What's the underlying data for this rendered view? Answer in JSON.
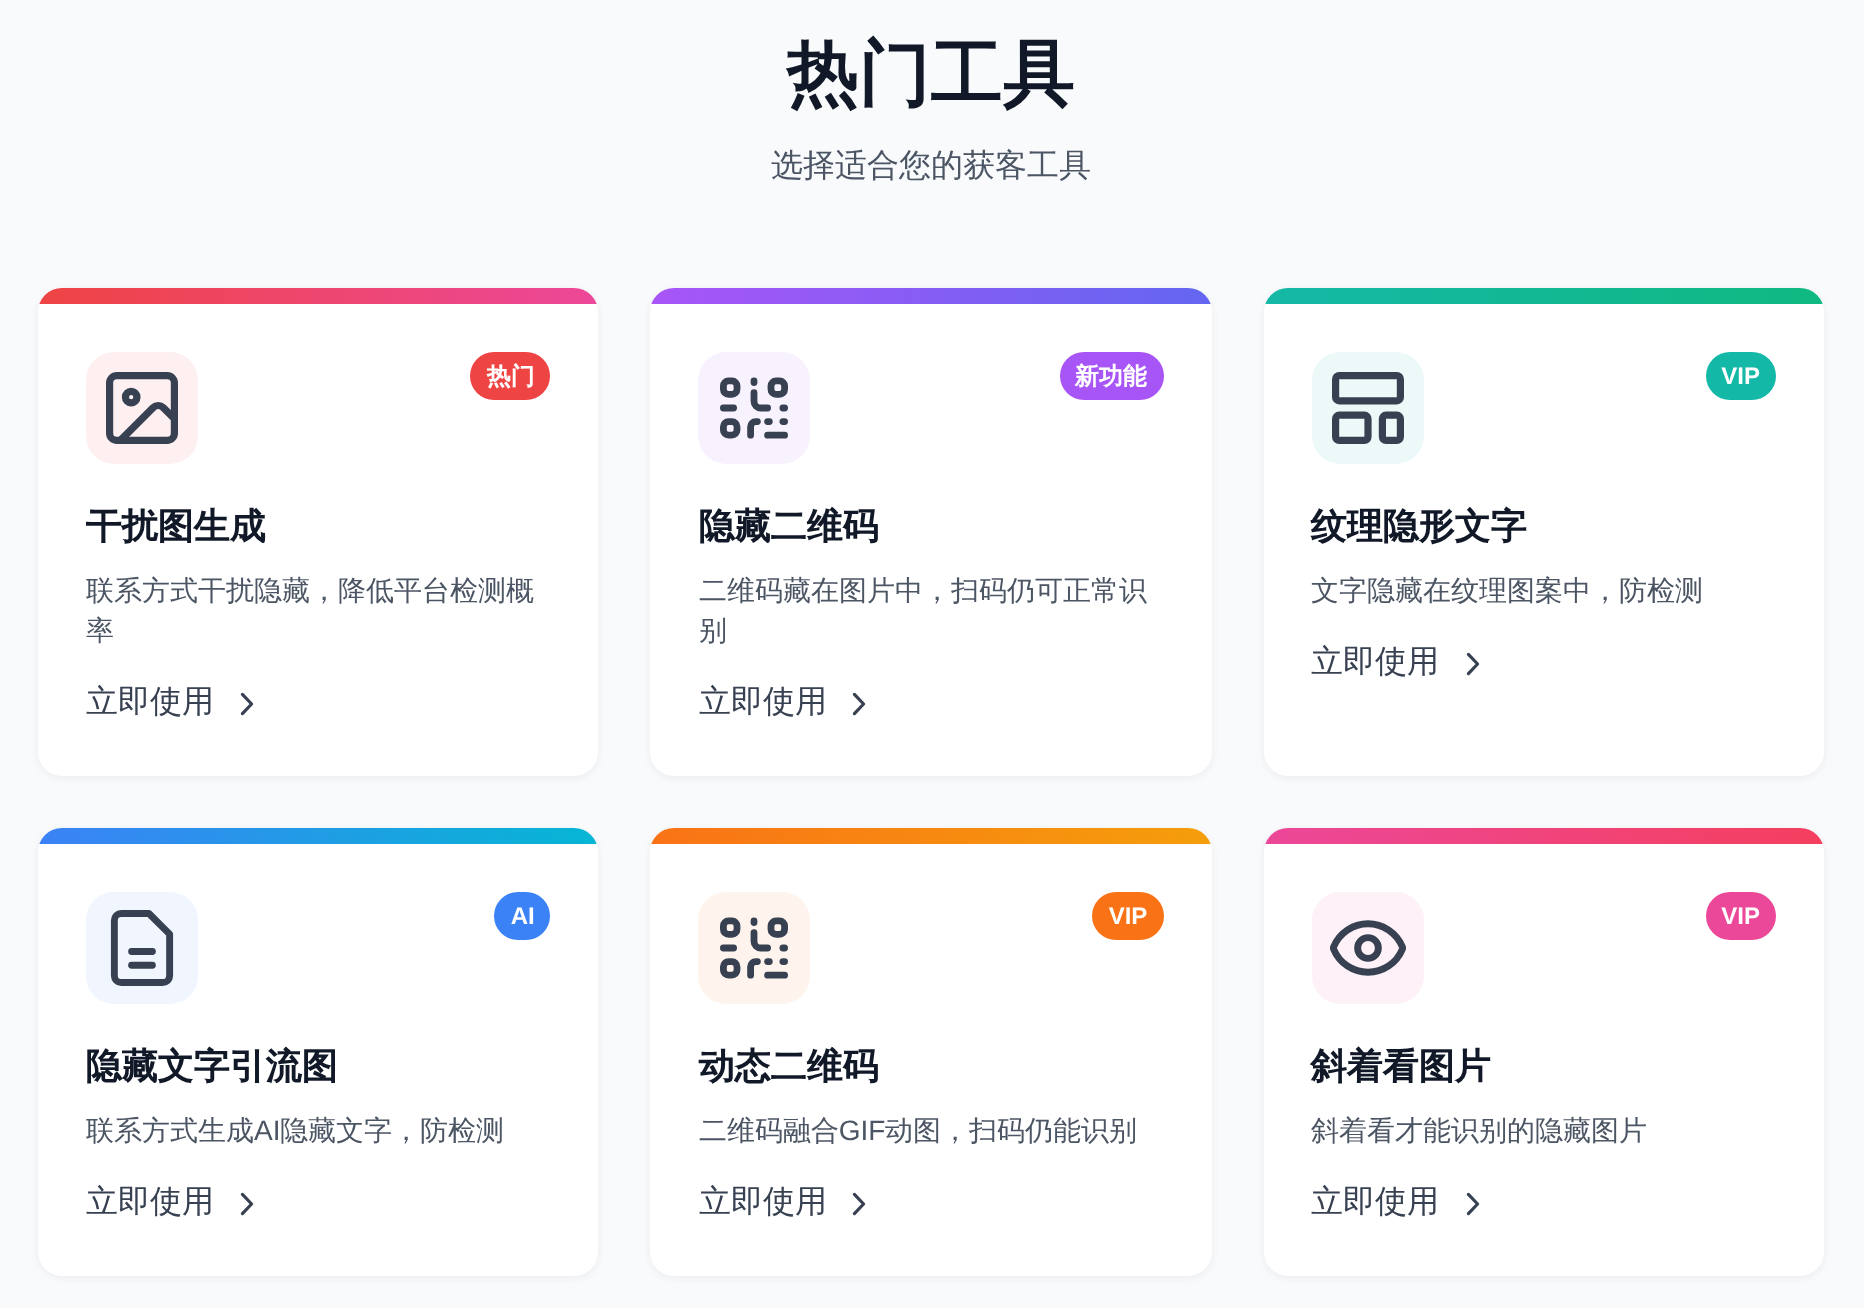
{
  "header": {
    "title": "热门工具",
    "subtitle": "选择适合您的获客工具"
  },
  "tools": [
    {
      "gradient": [
        {
          "color": "#ef4444"
        },
        {
          "color": "#ec4899"
        }
      ],
      "badge": "热门",
      "color": "#ef4444",
      "title": "干扰图生成",
      "description": "联系方式干扰隐藏，降低平台检测概率",
      "action": "立即使用"
    },
    {
      "gradient": [
        {
          "color": "#a855f7"
        },
        {
          "color": "#6366f1"
        }
      ],
      "badge": "新功能",
      "color": "#a855f7",
      "title": "隐藏二维码",
      "description": "二维码藏在图片中，扫码仍可正常识别",
      "action": "立即使用"
    },
    {
      "gradient": [
        {
          "color": "#14b8a6"
        },
        {
          "color": "#10b981"
        }
      ],
      "badge": "VIP",
      "color": "#14b8a6",
      "title": "纹理隐形文字",
      "description": "文字隐藏在纹理图案中，防检测",
      "action": "立即使用"
    },
    {
      "gradient": [
        {
          "color": "#3b82f6"
        },
        {
          "color": "#06b6d4"
        }
      ],
      "badge": "AI",
      "color": "#3b82f6",
      "title": "隐藏文字引流图",
      "description": "联系方式生成AI隐藏文字，防检测",
      "action": "立即使用"
    },
    {
      "gradient": [
        {
          "color": "#f97316"
        },
        {
          "color": "#f59e0b"
        }
      ],
      "badge": "VIP",
      "color": "#f97316",
      "title": "动态二维码",
      "description": "二维码融合GIF动图，扫码仍能识别",
      "action": "立即使用"
    },
    {
      "gradient": [
        {
          "color": "#ec4899"
        },
        {
          "color": "#f43f5e"
        }
      ],
      "badge": "VIP",
      "color": "#ec4899",
      "title": "斜着看图片",
      "description": "斜着看才能识别的隐藏图片",
      "action": "立即使用"
    }
  ]
}
